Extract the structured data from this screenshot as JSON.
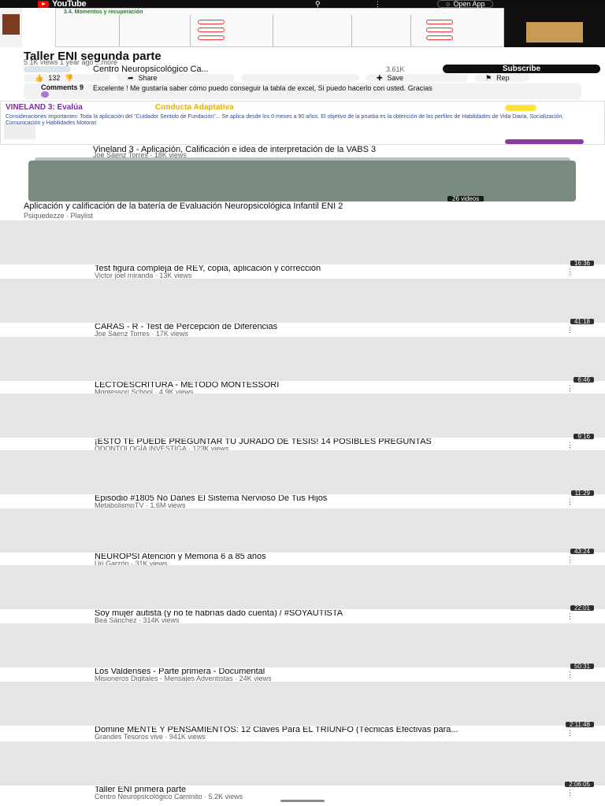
{
  "header": {
    "app_name": "YouTube",
    "open_app_label": "Open App"
  },
  "player": {
    "doc_heading": "3.4. Momentos y recuperación"
  },
  "video": {
    "title": "Taller ENI segunda parte",
    "meta": "5.1K views  1 year ago  ...more",
    "channel_name": "Centro Neuropsicológico Ca...",
    "subscriber_count": "3.61K",
    "subscribe_label": "Subscribe"
  },
  "actions": {
    "like_count": "132",
    "share_label": "Share",
    "save_label": "Save",
    "report_label": "Rep"
  },
  "comments": {
    "label": "Comments 9",
    "top_comment": "Excelente ! Me gustaría saber cómo puedo conseguir la tabla de excel, Si puedo hacerlo con usted. Gracias"
  },
  "ad": {
    "heading": "VINELAND 3: Evalúa",
    "heading_highlight": "Conducta Adaptativa",
    "body": "Consideraciones importantes: Toda la aplicación del \"Cuidador Sentido de Fundación\"... Se aplica desde los 0 meses a 90 años. El objetivo de la prueba es la obtención de los perfiles de Habilidades de Vida Diaria, Socialización, Comunicación y Habilidades Motoras"
  },
  "recommended": {
    "title": "Vineland 3 - Aplicación, Calificación e idea de interpretación de la VABS 3",
    "meta": "Joe Sáenz Torres · 18K views"
  },
  "playlist": {
    "count_label": "26 videos",
    "title": "Aplicación y calificación de la batería de Evaluación Neuropsicológica Infantil ENI 2",
    "meta": "Psiquedezze · Playlist"
  },
  "videos": [
    {
      "duration": "16:36",
      "title": "Test figura compleja de REY, copia, aplicación y corrección",
      "meta": "Victor joel miranda · 13K views"
    },
    {
      "duration": "41:18",
      "title": "CARAS - R - Test de Percepción de Diferencias",
      "meta": "Joe Sáenz Torres · 17K views"
    },
    {
      "duration": "6:46",
      "title": "LECTOESCRITURA - MÉTODO MONTESSORI",
      "meta": "Montessori School · 4.9K views"
    },
    {
      "duration": "9:16",
      "title": "¡ESTO TE PUEDE PREGUNTAR TU JURADO DE TESIS! 14 POSIBLES PREGUNTAS",
      "meta": "ODONTOLOGÍA INVESTIGA · 123K views"
    },
    {
      "duration": "11:29",
      "title": "Episodio #1805 No Dañes El Sistema Nervioso De Tus Hijos",
      "meta": "MetabolismoTV · 1.6M views"
    },
    {
      "duration": "43:24",
      "title": "NEUROPSI Atención y Memoria 6 a 85 años",
      "meta": "Uri Garzón · 31K views"
    },
    {
      "duration": "22:01",
      "title": "Soy mujer autista (y no te habrías dado cuenta) / #SOYAUTISTA",
      "meta": "Bea Sánchez · 314K views"
    },
    {
      "duration": "50:31",
      "title": "Los Valdenses - Parte primera - Documental",
      "meta": "Misioneros Digitales - Mensajes Adventistas · 24K views"
    },
    {
      "duration": "2:11:48",
      "title": "Domine MENTE Y PENSAMIENTOS: 12 Claves Para EL TRIUNFO (Técnicas Efectivas para...",
      "meta": "Grandes Tesoros vive · 941K views"
    },
    {
      "duration": "2:06:05",
      "title": "Taller ENI primera parte",
      "meta": "Centro Neuropsicológico Caminito · 5.2K views"
    }
  ]
}
